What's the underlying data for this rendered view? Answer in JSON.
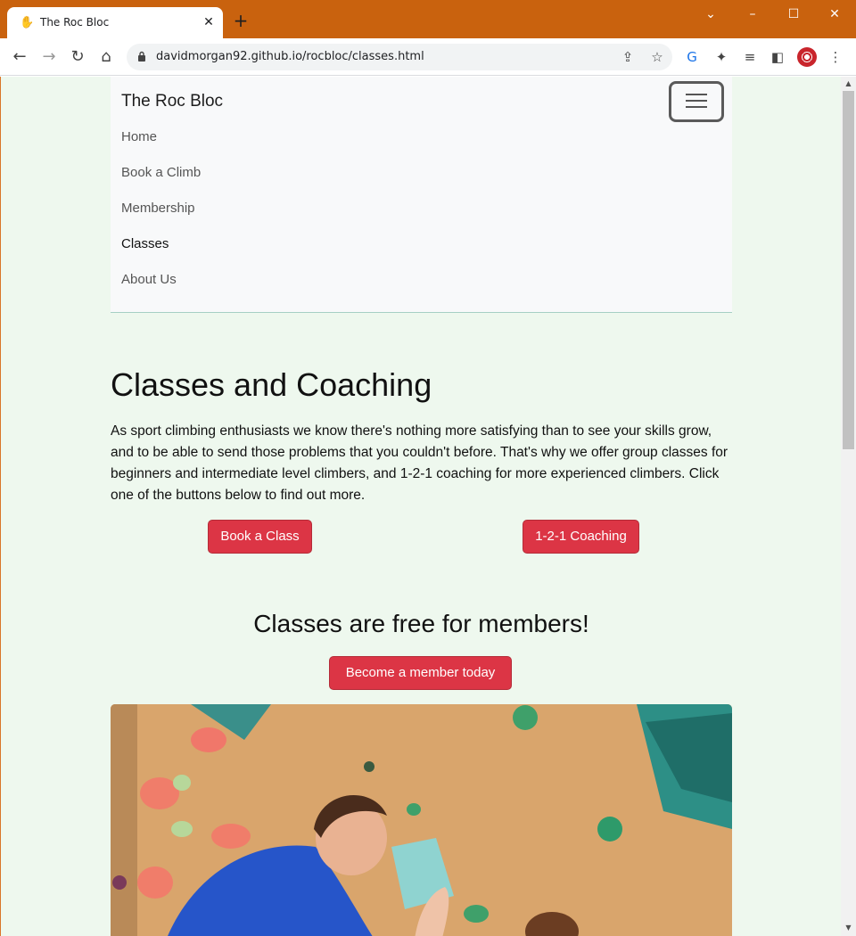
{
  "browser": {
    "tab_title": "The Roc Bloc",
    "url": "davidmorgan92.github.io/rocbloc/classes.html"
  },
  "navbar": {
    "brand": "The Roc Bloc",
    "links": [
      {
        "label": "Home"
      },
      {
        "label": "Book a Climb"
      },
      {
        "label": "Membership"
      },
      {
        "label": "Classes"
      },
      {
        "label": "About Us"
      }
    ],
    "active": "Classes"
  },
  "main": {
    "title": "Classes and Coaching",
    "intro": "As sport climbing enthusiasts we know there's nothing more satisfying than to see your skills grow, and to be able to send those problems that you couldn't before. That's why we offer group classes for beginners and intermediate level climbers, and 1-2-1 coaching for more experienced climbers. Click one of the buttons below to find out more.",
    "book_class_label": "Book a Class",
    "coaching_label": "1-2-1 Coaching",
    "members_heading": "Classes are free for members!",
    "member_button_label": "Become a member today"
  },
  "colors": {
    "titlebar": "#c9620e",
    "page_bg": "#eef8ee",
    "button_red": "#dc3545"
  }
}
